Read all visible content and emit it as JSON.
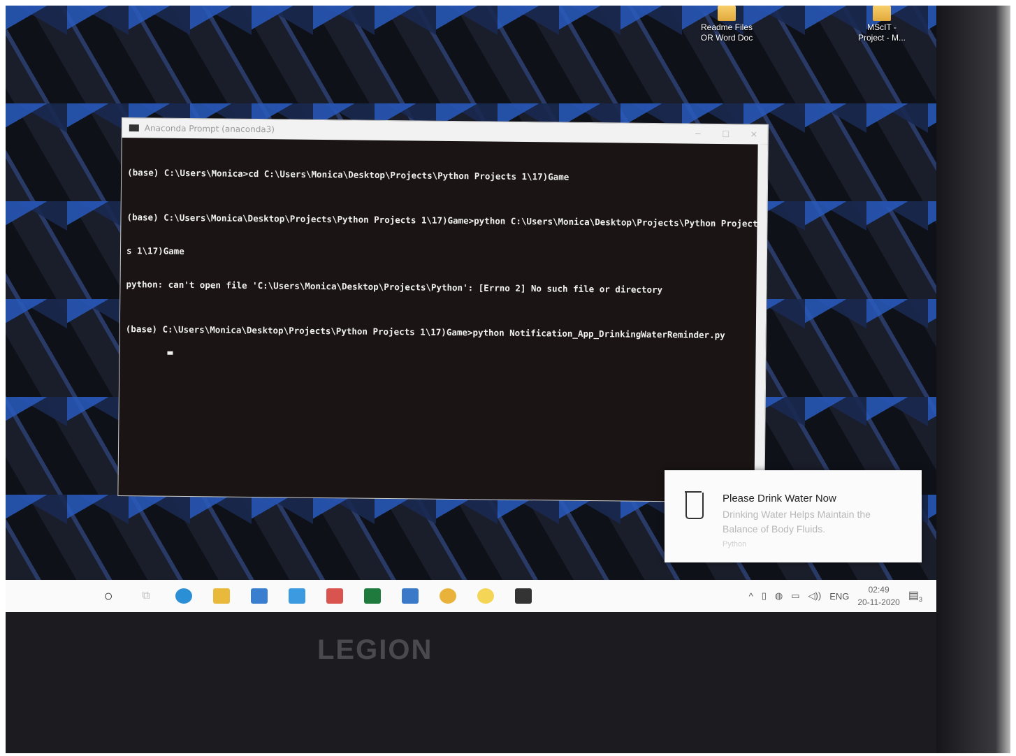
{
  "desktop": {
    "icons": [
      {
        "label_line1": "Readme Files",
        "label_line2": "OR Word Doc"
      },
      {
        "label_line1": "MScIT -",
        "label_line2": "Project - M..."
      }
    ]
  },
  "terminal": {
    "title": "Anaconda Prompt (anaconda3)",
    "lines": [
      "(base) C:\\Users\\Monica>cd C:\\Users\\Monica\\Desktop\\Projects\\Python Projects 1\\17)Game",
      "(base) C:\\Users\\Monica\\Desktop\\Projects\\Python Projects 1\\17)Game>python C:\\Users\\Monica\\Desktop\\Projects\\Python Project",
      "s 1\\17)Game",
      "python: can't open file 'C:\\Users\\Monica\\Desktop\\Projects\\Python': [Errno 2] No such file or directory",
      "(base) C:\\Users\\Monica\\Desktop\\Projects\\Python Projects 1\\17)Game>python Notification_App_DrinkingWaterReminder.py"
    ]
  },
  "notification": {
    "title": "Please Drink Water Now",
    "body": "Drinking Water Helps Maintain the Balance of Body Fluids.",
    "app": "Python",
    "icon": "water-glass-icon"
  },
  "taskbar": {
    "apps": [
      {
        "name": "cortana-icon",
        "glyph": "○"
      },
      {
        "name": "task-view-icon",
        "glyph": "⧉"
      },
      {
        "name": "edge-icon",
        "color": "#2b8fd6"
      },
      {
        "name": "file-explorer-icon",
        "color": "#e8b93b"
      },
      {
        "name": "mail-icon",
        "color": "#3a7fcf"
      },
      {
        "name": "word-like-icon",
        "color": "#3c9be0"
      },
      {
        "name": "office-icon",
        "color": "#d9534f"
      },
      {
        "name": "excel-icon",
        "color": "#1f7a3e"
      },
      {
        "name": "remote-icon",
        "color": "#3a78c8"
      },
      {
        "name": "chrome-icon",
        "color": "#e9b23a"
      },
      {
        "name": "loading-icon",
        "color": "#f1c40f"
      },
      {
        "name": "terminal-icon",
        "color": "#333333"
      }
    ],
    "tray": {
      "language": "ENG",
      "time": "02:49",
      "date": "20-11-2020",
      "notification_count": "3"
    }
  },
  "device": {
    "brand": "LEGION"
  }
}
